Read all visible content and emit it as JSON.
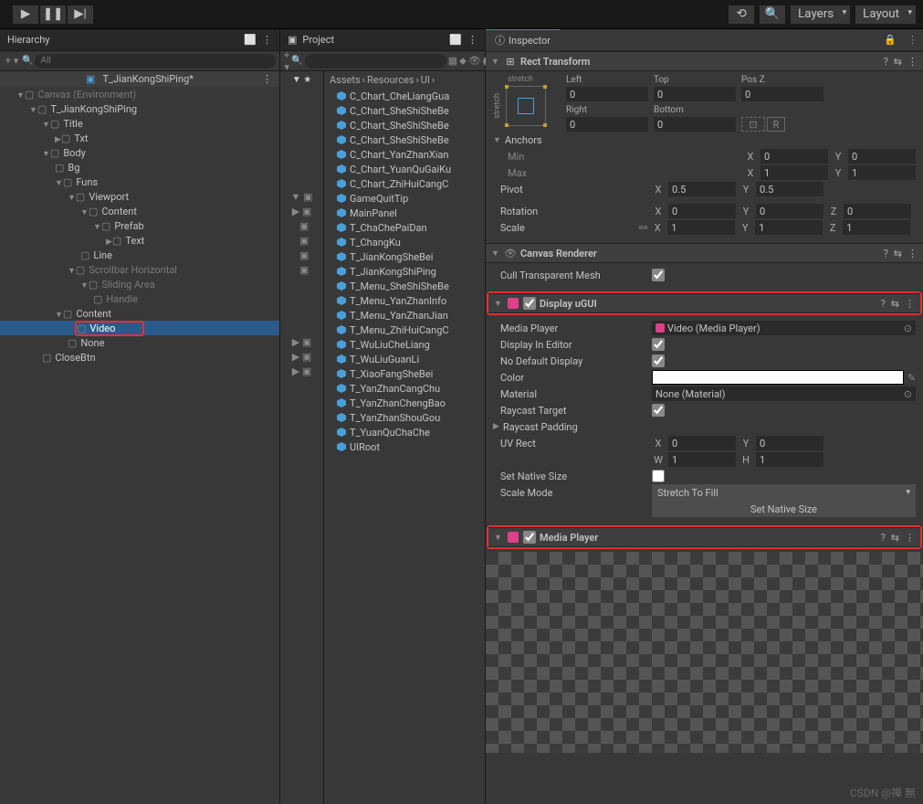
{
  "topbar": {
    "layers": "Layers",
    "layout": "Layout"
  },
  "hierarchy": {
    "title": "Hierarchy",
    "search_placeholder": "All",
    "scene": "T_JianKongShiPing*",
    "tree": [
      {
        "d": 0,
        "f": "▼",
        "t": "Canvas (Environment)",
        "dim": true
      },
      {
        "d": 1,
        "f": "▼",
        "t": "T_JianKongShiPing"
      },
      {
        "d": 2,
        "f": "▼",
        "t": "Title"
      },
      {
        "d": 3,
        "f": "▶",
        "t": "Txt"
      },
      {
        "d": 2,
        "f": "▼",
        "t": "Body"
      },
      {
        "d": 3,
        "f": "",
        "t": "Bg"
      },
      {
        "d": 3,
        "f": "▼",
        "t": "Funs"
      },
      {
        "d": 4,
        "f": "▼",
        "t": "Viewport"
      },
      {
        "d": 5,
        "f": "▼",
        "t": "Content"
      },
      {
        "d": 6,
        "f": "▼",
        "t": "Prefab"
      },
      {
        "d": 7,
        "f": "▶",
        "t": "Text"
      },
      {
        "d": 5,
        "f": "",
        "t": "Line"
      },
      {
        "d": 4,
        "f": "▼",
        "t": "Scrollbar Horizontal",
        "dim": true
      },
      {
        "d": 5,
        "f": "▼",
        "t": "Sliding Area",
        "dim": true
      },
      {
        "d": 6,
        "f": "",
        "t": "Handle",
        "dim": true
      },
      {
        "d": 3,
        "f": "▼",
        "t": "Content"
      },
      {
        "d": 4,
        "f": "",
        "t": "Video",
        "sel": true,
        "hl": true
      },
      {
        "d": 4,
        "f": "",
        "t": "None"
      },
      {
        "d": 2,
        "f": "",
        "t": "CloseBtn"
      }
    ]
  },
  "project": {
    "title": "Project",
    "breadcrumb": [
      "Assets",
      "Resources",
      "UI"
    ],
    "assets": [
      "C_Chart_CheLiangGua",
      "C_Chart_SheShiSheBe",
      "C_Chart_SheShiSheBe",
      "C_Chart_SheShiSheBe",
      "C_Chart_YanZhanXian",
      "C_Chart_YuanQuGaiKu",
      "C_Chart_ZhiHuiCangC",
      "GameQuitTip",
      "MainPanel",
      "T_ChaChePaiDan",
      "T_ChangKu",
      "T_JianKongSheBei",
      "T_JianKongShiPing",
      "T_Menu_SheShiSheBe",
      "T_Menu_YanZhanInfo",
      "T_Menu_YanZhanJian",
      "T_Menu_ZhiHuiCangC",
      "T_WuLiuCheLiang",
      "T_WuLiuGuanLi",
      "T_XiaoFangSheBei",
      "T_YanZhanCangChu",
      "T_YanZhanChengBao",
      "T_YanZhanShouGou",
      "T_YuanQuChaChe",
      "UIRoot"
    ]
  },
  "inspector": {
    "title": "Inspector",
    "rect": {
      "name": "Rect Transform",
      "stretch": "stretch",
      "left": "Left",
      "left_v": "0",
      "top": "Top",
      "top_v": "0",
      "posz": "Pos Z",
      "posz_v": "0",
      "right": "Right",
      "right_v": "0",
      "bottom": "Bottom",
      "bottom_v": "0",
      "anchors": "Anchors",
      "min": "Min",
      "min_x": "0",
      "min_y": "0",
      "max": "Max",
      "max_x": "1",
      "max_y": "1",
      "pivot": "Pivot",
      "pivot_x": "0.5",
      "pivot_y": "0.5",
      "rotation": "Rotation",
      "rot_x": "0",
      "rot_y": "0",
      "rot_z": "0",
      "scale": "Scale",
      "scl_x": "1",
      "scl_y": "1",
      "scl_z": "1"
    },
    "canvas_renderer": {
      "name": "Canvas Renderer",
      "cull": "Cull Transparent Mesh"
    },
    "display_ugui": {
      "name": "Display uGUI",
      "media_player": "Media Player",
      "media_player_val": "Video (Media Player)",
      "display_in_editor": "Display In Editor",
      "no_default": "No Default Display",
      "color": "Color",
      "material": "Material",
      "material_val": "None (Material)",
      "raycast": "Raycast Target",
      "raycast_padding": "Raycast Padding",
      "uv_rect": "UV Rect",
      "uv_x": "0",
      "uv_y": "0",
      "uv_w": "1",
      "uv_h": "1",
      "set_native": "Set Native Size",
      "scale_mode": "Scale Mode",
      "scale_mode_val": "Stretch To Fill",
      "set_native_btn": "Set Native Size"
    },
    "media_player": {
      "name": "Media Player"
    }
  },
  "watermark": "CSDN @禪 無"
}
